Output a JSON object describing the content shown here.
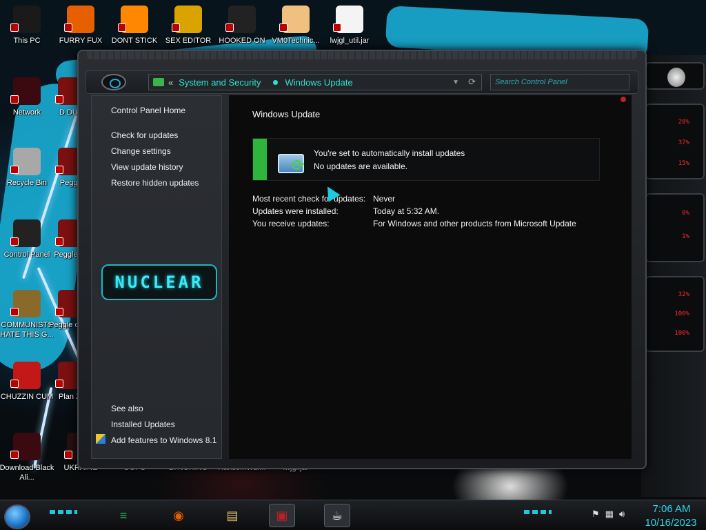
{
  "desktop": {
    "top_row": [
      {
        "label": "This PC",
        "icon": "computer-icon",
        "color": "#1a1a1a"
      },
      {
        "label": "FURRY FUX",
        "icon": "firefox-icon",
        "color": "#e66000"
      },
      {
        "label": "DONT STICK",
        "icon": "vlc-icon",
        "color": "#ff8800"
      },
      {
        "label": "SEX EDITOR",
        "icon": "hex-editor-icon",
        "color": "#d9a400"
      },
      {
        "label": "HOOKED ON",
        "icon": "maze-icon",
        "color": "#222222"
      },
      {
        "label": "VM0Technic...",
        "icon": "person-icon",
        "color": "#f0c080"
      },
      {
        "label": "lwjgl_util.jar",
        "icon": "java-icon",
        "color": "#f4f4f4"
      }
    ],
    "left_col": [
      {
        "label": "Network",
        "icon": "network-icon"
      },
      {
        "label": "Recycle Bin",
        "icon": "recycle-bin-icon"
      },
      {
        "label": "Control Panel",
        "icon": "control-panel-icon"
      },
      {
        "label": "COMMUNISTS HATE THIS G...",
        "icon": "money-bag-icon"
      },
      {
        "label": "CHUZZIN CUM",
        "icon": "chuzzle-icon"
      },
      {
        "label": "Download Black Ali...",
        "icon": "alien-icon"
      }
    ],
    "second_col": [
      {
        "label": "D DUM"
      },
      {
        "label": "Peggle"
      },
      {
        "label": "Peggle De"
      },
      {
        "label": "Peggle of Wa"
      },
      {
        "label": "Plan Zo"
      }
    ],
    "bottom_row": [
      {
        "label": "UKRAINE"
      },
      {
        "label": "OOPS"
      },
      {
        "label": "LYNCHING"
      },
      {
        "label": "RansomWar..."
      },
      {
        "label": "lwjgl.jar"
      }
    ]
  },
  "window": {
    "breadcrumb": {
      "back_glyph": "«",
      "items": [
        "System and Security",
        "Windows Update"
      ]
    },
    "search_placeholder": "Search Control Panel",
    "left_nav": {
      "home": "Control Panel Home",
      "links": [
        "Check for updates",
        "Change settings",
        "View update history",
        "Restore hidden updates"
      ],
      "logo_text": "NUCLEAR",
      "see_also_title": "See also",
      "see_also": [
        "Installed Updates",
        "Add features to Windows 8.1"
      ]
    },
    "main": {
      "heading": "Windows Update",
      "status_title": "You're set to automatically install updates",
      "status_detail": "No updates are available.",
      "status_color": "#2fb53b",
      "details": [
        {
          "label": "Most recent check for updates:",
          "value": "Never"
        },
        {
          "label": "Updates were installed:",
          "value": "Today at 5:32 AM."
        },
        {
          "label": "You receive updates:",
          "value": "For Windows and other products from Microsoft Update"
        }
      ]
    }
  },
  "gadgets": {
    "percent_readouts": [
      "28%",
      "37%",
      "15%",
      "0%",
      "1%",
      "32%",
      "100%",
      "100%"
    ]
  },
  "taskbar": {
    "apps": [
      {
        "name": "notes-app-icon",
        "glyph": "≡",
        "color": "#2ec05a"
      },
      {
        "name": "firefox-icon",
        "glyph": "◉",
        "color": "#e66000"
      },
      {
        "name": "file-explorer-icon",
        "glyph": "▤",
        "color": "#e9c46a"
      },
      {
        "name": "control-panel-icon",
        "glyph": "▣",
        "color": "#c02020",
        "active": true
      },
      {
        "name": "java-icon",
        "glyph": "☕",
        "color": "#f2f2f2",
        "active": true
      }
    ],
    "clock_time": "7:06 AM",
    "clock_date": "10/16/2023"
  }
}
